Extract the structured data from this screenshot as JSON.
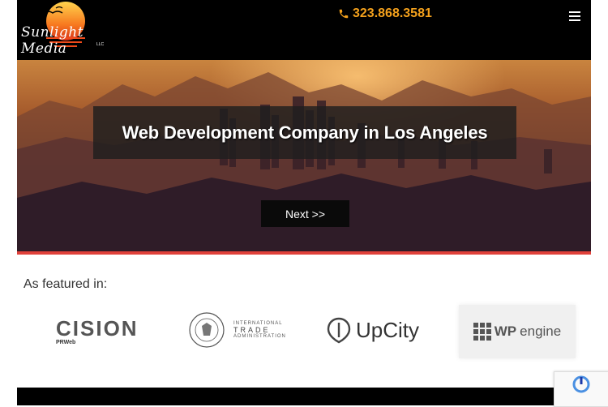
{
  "header": {
    "logo_text": "Sunlight Media",
    "logo_llc": "LLC",
    "phone": "323.868.3581",
    "menu_icon": "hamburger-menu-icon"
  },
  "hero": {
    "title": "Web Development Company in Los Angeles",
    "next_button": "Next >>"
  },
  "featured": {
    "title": "As featured in:",
    "logos": {
      "cision": "CISION",
      "cision_sub": "PRWeb",
      "ita_line1": "INTERNATIONAL",
      "ita_line2": "TRADE",
      "ita_line3": "ADMINISTRATION",
      "upcity": "UpCity",
      "wp": "WP",
      "engine": "engine"
    }
  },
  "colors": {
    "accent": "#f4a11c",
    "red_bar": "#e0413b"
  }
}
